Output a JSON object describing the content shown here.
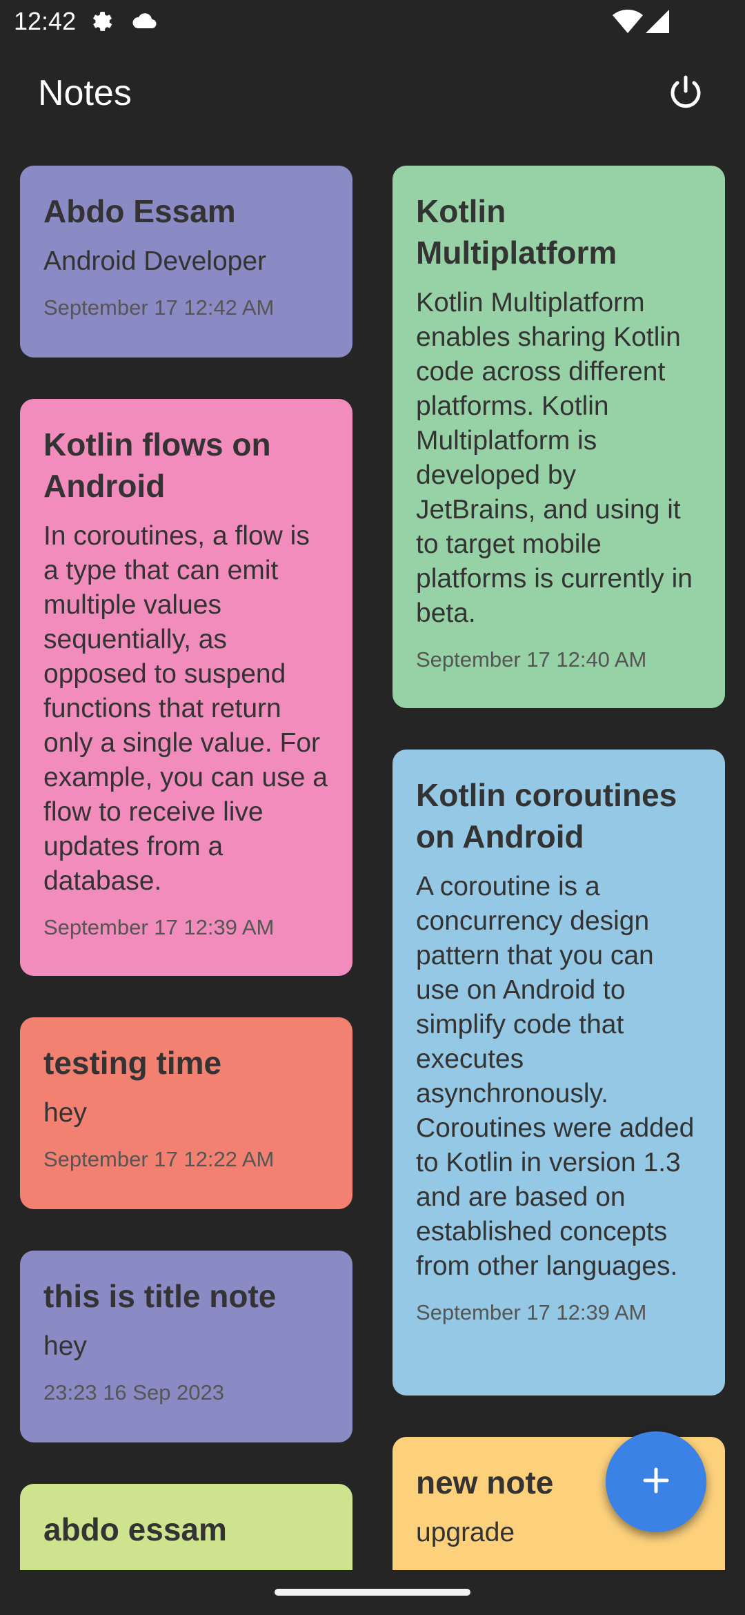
{
  "status_bar": {
    "time": "12:42",
    "icons": [
      "settings-gear-icon",
      "cloud-icon",
      "wifi-icon",
      "signal-icon"
    ]
  },
  "app_bar": {
    "title": "Notes",
    "power_icon": "power-icon"
  },
  "notes": [
    {
      "title": "Abdo Essam",
      "body": "Android Developer",
      "date": "September 17 12:42 AM",
      "color": "#8a8ac4"
    },
    {
      "title": "Kotlin Multiplatform",
      "body": "Kotlin Multiplatform enables sharing Kotlin code across different platforms. Kotlin Multiplatform is developed by JetBrains, and using it to target mobile platforms is currently in beta.",
      "date": "September 17 12:40 AM",
      "color": "#97d2a6"
    },
    {
      "title": "Kotlin flows on Android",
      "body": "In coroutines, a flow is a type that can emit multiple values sequentially, as opposed to suspend functions that return only a single value. For example, you can use a flow to receive live updates from a database.",
      "date": "September 17 12:39 AM",
      "color": "#f28cbd"
    },
    {
      "title": "Kotlin coroutines on Android",
      "body": "A coroutine is a concurrency design pattern that you can use on Android to simplify code that executes asynchronously. Coroutines were added to Kotlin in version 1.3 and are based on established concepts from other languages.",
      "date": "September 17 12:39 AM",
      "color": "#94c8e4"
    },
    {
      "title": "testing time",
      "body": "hey",
      "date": "September 17 12:22 AM",
      "color": "#f28171"
    },
    {
      "title": "this is title note",
      "body": "hey",
      "date": "23:23 16 Sep 2023",
      "color": "#8a8ac4"
    },
    {
      "title": "new note",
      "body": "upgrade",
      "date": "",
      "color": "#fdd17c"
    },
    {
      "title": "abdo essam",
      "body": "",
      "date": "",
      "color": "#cde38d"
    }
  ],
  "fab": {
    "icon": "plus-icon",
    "color": "#3b82e6"
  }
}
